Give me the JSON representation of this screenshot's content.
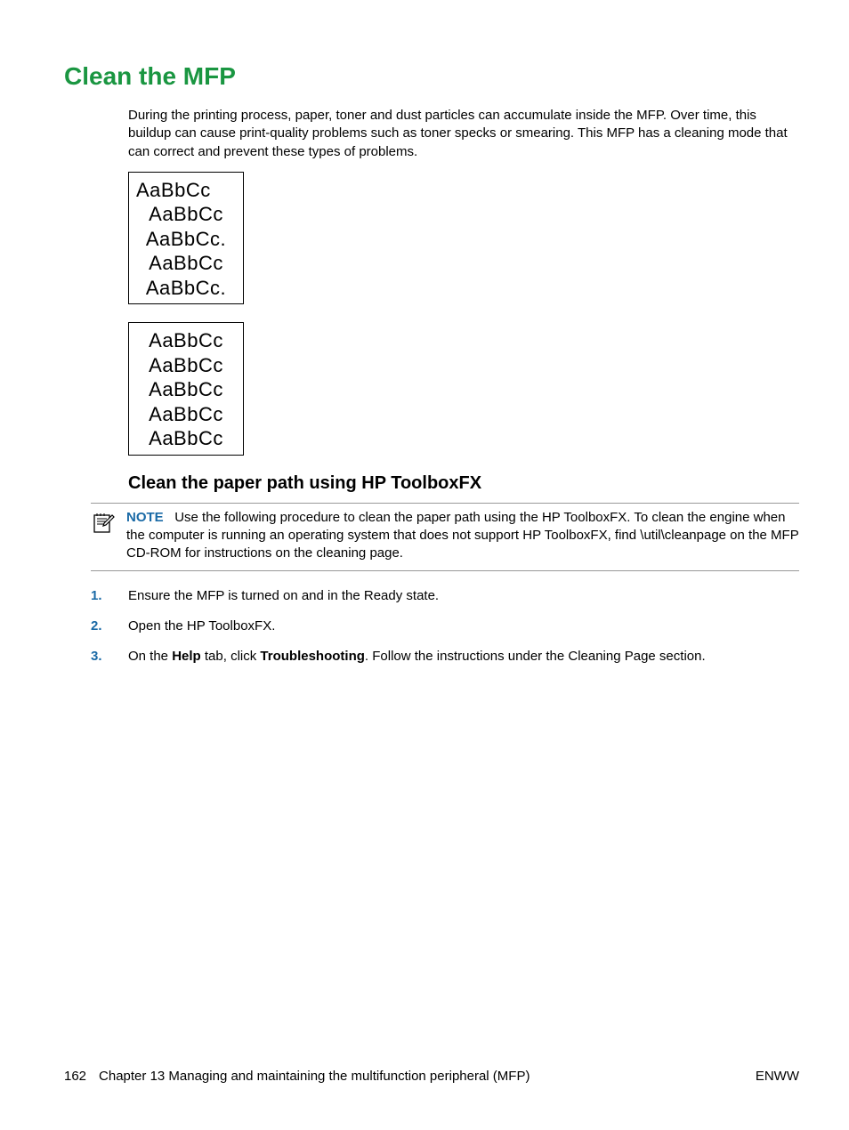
{
  "title": "Clean the MFP",
  "intro": "During the printing process, paper, toner and dust particles can accumulate inside the MFP. Over time, this buildup can cause print-quality problems such as toner specks or smearing. This MFP has a cleaning mode that can correct and prevent these types of problems.",
  "sample1": {
    "lines": [
      "AaBbCc",
      "AaBbCc",
      "AaBbCc.",
      "AaBbCc",
      "AaBbCc."
    ]
  },
  "sample2": {
    "lines": [
      "AaBbCc",
      "AaBbCc",
      "AaBbCc",
      "AaBbCc",
      "AaBbCc"
    ]
  },
  "subhead": "Clean the paper path using HP ToolboxFX",
  "note": {
    "label": "NOTE",
    "text": "Use the following procedure to clean the paper path using the HP ToolboxFX. To clean the engine when the computer is running an operating system that does not support HP ToolboxFX, find \\util\\cleanpage on the MFP CD-ROM for instructions on the cleaning page."
  },
  "steps": {
    "s1": "Ensure the MFP is turned on and in the Ready state.",
    "s2": "Open the HP ToolboxFX.",
    "s3_pre": "On the ",
    "s3_b1": "Help",
    "s3_mid": " tab, click ",
    "s3_b2": "Troubleshooting",
    "s3_post": ". Follow the instructions under the Cleaning Page section."
  },
  "footer": {
    "page": "162",
    "chapter": "Chapter 13   Managing and maintaining the multifunction peripheral (MFP)",
    "right": "ENWW"
  }
}
